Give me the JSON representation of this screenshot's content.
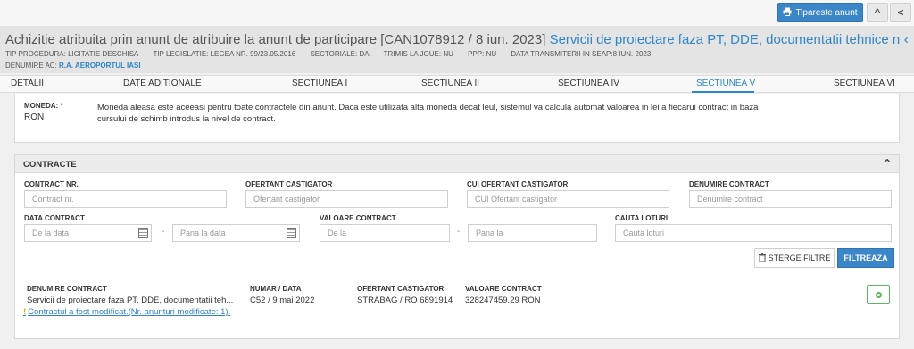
{
  "topbar": {
    "print_label": "Tipareste anunt",
    "collapse_icon": "^",
    "more_icon": "<"
  },
  "header": {
    "title_prefix": "Achizitie atribuita prin anunt de atribuire la anunt de participare [CAN1078912 / 8 iun. 2023]",
    "title_link": "Servicii de proiectare faza PT, DDE, documentatii tehnice necesare in ved...",
    "meta": [
      "TIP PROCEDURA: LICITATIE DESCHISA",
      "TIP LEGISLATIE: LEGEA NR. 99/23.05.2016",
      "SECTORIALE: DA",
      "TRIMIS LA JOUE: NU",
      "PPP: NU",
      "DATA TRANSMITERII IN SEAP:8 IUN. 2023"
    ],
    "authority_label": "DENUMIRE AC:",
    "authority_name": "R.A. AEROPORTUL IASI"
  },
  "tabs": [
    "DETALII",
    "DATE ADITIONALE",
    "SECTIUNEA I",
    "SECTIUNEA II",
    "SECTIUNEA IV",
    "SECTIUNEA V",
    "SECTIUNEA VI"
  ],
  "active_tab": "SECTIUNEA V",
  "moneda": {
    "label": "MONEDA:",
    "required_mark": "*",
    "value": "RON",
    "description": "Moneda aleasa este aceeasi pentru toate contractele din anunt. Daca este utilizata alta moneda decat leul, sistemul va calcula automat valoarea in lei a fiecarui contract in baza cursului de schimb introdus la nivel de contract."
  },
  "contracte": {
    "title": "CONTRACTE",
    "filters": {
      "contract_nr": {
        "label": "CONTRACT NR.",
        "placeholder": "Contract nr."
      },
      "ofertant": {
        "label": "OFERTANT CASTIGATOR",
        "placeholder": "Ofertant castigator"
      },
      "cui": {
        "label": "CUI OFERTANT CASTIGATOR",
        "placeholder": "CUI Ofertant castigator"
      },
      "denumire": {
        "label": "DENUMIRE CONTRACT",
        "placeholder": "Denumire contract"
      },
      "data": {
        "label": "DATA CONTRACT",
        "from_placeholder": "De la data",
        "to_placeholder": "Pana la data"
      },
      "valoare": {
        "label": "VALOARE CONTRACT",
        "from_placeholder": "De la",
        "to_placeholder": "Pana la"
      },
      "loturi": {
        "label": "CAUTA LOTURI",
        "placeholder": "Cauta loturi"
      },
      "dash": "-"
    },
    "clear_label": "STERGE FILTRE",
    "filter_label": "FILTREAZA",
    "columns": {
      "denumire": "DENUMIRE CONTRACT",
      "numar_data": "NUMAR / DATA",
      "ofertant": "OFERTANT CASTIGATOR",
      "valoare": "VALOARE CONTRACT"
    },
    "rows": [
      {
        "denumire": "Servicii de proiectare faza PT, DDE, documentatii teh...",
        "modified_link": "Contractul a fost modificat.(Nr. anunturi modificate: 1).",
        "warn_mark": "!",
        "numar_data": "C52 / 9 mai 2022",
        "ofertant": "STRABAG / RO 6891914",
        "valoare": "328247459.29 RON"
      }
    ]
  }
}
